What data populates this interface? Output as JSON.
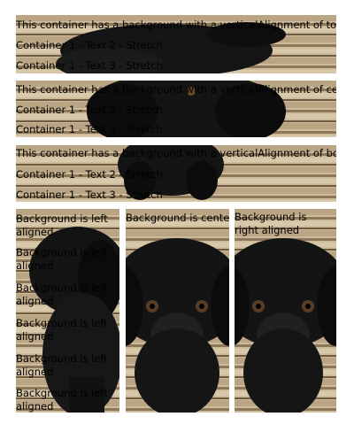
{
  "top_band": {
    "heading": "This container has a background with a verticalAlignment of top",
    "text2": "Container 1 - Text 2 - Stretch",
    "text3": "Container 1 - Text 3 - Stretch"
  },
  "center_band": {
    "heading": "This container has a background with a verticalAlignment of center",
    "text2": "Container 1 - Text 2 - Stretch",
    "text3": "Container 1 - Text 3 - Stretch"
  },
  "bottom_band": {
    "heading": "This container has a background with a verticalAlignment of bottom",
    "text2": "Container 1 - Text 2 - Stretch",
    "text3": "Container 1 - Text 3 - Stretch"
  },
  "left_column": {
    "items": [
      "Background is left aligned",
      "Background is left aligned",
      "Background is left aligned",
      "Background is left aligned",
      "Background is left aligned",
      "Background is left aligned"
    ]
  },
  "center_column": {
    "label": "Background is center"
  },
  "right_column": {
    "label": "Background is right aligned"
  },
  "background_image": "black-puppy-photo",
  "colors": {
    "wood_light": "#d1bf9f",
    "wood_dark": "#5e4a36",
    "dog": "#151515",
    "divider": "#ffffff"
  }
}
